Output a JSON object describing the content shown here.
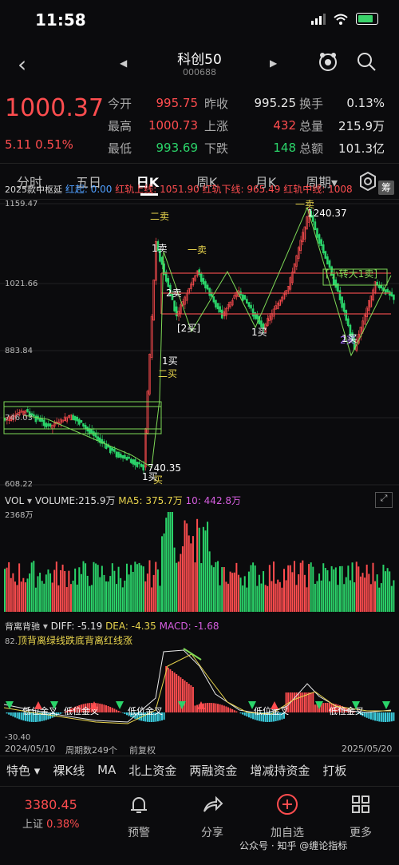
{
  "status": {
    "time": "11:58"
  },
  "header": {
    "title": "科创50",
    "code": "000688"
  },
  "quote": {
    "price": "1000.37",
    "change": "5.11  0.51%",
    "rows": [
      {
        "l1": "今开",
        "v1": "995.75",
        "l2": "昨收",
        "v2": "995.25",
        "l3": "换手",
        "v3": "0.13%"
      },
      {
        "l1": "最高",
        "v1": "1000.73",
        "l2": "上涨",
        "v2": "432",
        "l3": "总量",
        "v3": "215.9万"
      },
      {
        "l1": "最低",
        "v1": "993.69",
        "l2": "下跌",
        "v2": "148",
        "l3": "总额",
        "v3": "101.3亿"
      }
    ]
  },
  "tabs": [
    "分时",
    "五日",
    "日K",
    "周K",
    "月K",
    "周期"
  ],
  "indicator": {
    "name": "2025款中枢延",
    "start": "红起: 0.00",
    "upper": "红轨上线: 1051.90",
    "lower": "红轨下线: 965.49",
    "middle": "红轨中线: 1008",
    "badge": "筹"
  },
  "price_axis": [
    "1159.47",
    "1021.66",
    "883.84",
    "746.03",
    "608.22"
  ],
  "annotations": {
    "hi": "1240.37",
    "lo": "740.35",
    "sell2": "二卖",
    "sell1a": "1卖",
    "sell1b": "一卖",
    "sell2b": "2卖",
    "buy2b": "[2买]",
    "buy1a": "1买",
    "buy2a": "二买",
    "buy1b": "1买",
    "sell1c": "一卖",
    "trans": "[小转大1卖]",
    "buy1c": "1买",
    "buy2c": "2买",
    "buy1d": "1买",
    "buy1e": "买"
  },
  "volume": {
    "label": "VOL",
    "vol": "VOLUME:215.9万",
    "ma5": "MA5: 375.7万",
    "ma10": "10: 442.8万",
    "max": "2368万"
  },
  "macd": {
    "name": "背离背驰",
    "diff": "DIFF: -5.19",
    "dea": "DEA: -4.35",
    "macd": "MACD: -1.68",
    "caption": "顶背离绿线跌底背离红线涨",
    "top": "82.",
    "bottom": "-30.40",
    "tags": [
      "低位金叉",
      "低位金叉",
      "低位金叉",
      "低位金叉",
      "低位金叉"
    ]
  },
  "dates": {
    "start": "2024/05/10",
    "count": "周期数249个",
    "mode": "前复权",
    "end": "2025/05/20"
  },
  "tools": [
    "特色",
    "裸K线",
    "MA",
    "北上资金",
    "两融资金",
    "增减持资金",
    "打板"
  ],
  "bottom": {
    "index_value": "3380.45",
    "index_name": "上证",
    "index_change": "0.38%",
    "items": [
      "预警",
      "分享",
      "加自选",
      "更多"
    ]
  },
  "watermark": "公众号 · 知乎 @缠论指标",
  "colors": {
    "up": "#ff4d4f",
    "down": "#2bd46a",
    "yellow": "#e8d44d"
  }
}
